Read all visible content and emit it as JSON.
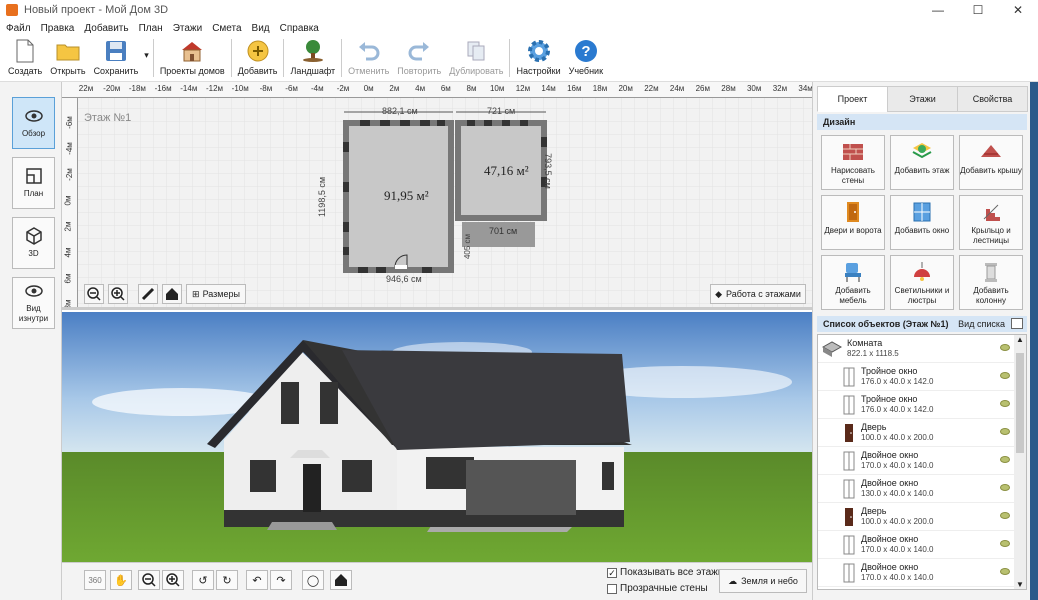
{
  "window": {
    "title": "Новый проект - Мой Дом 3D"
  },
  "menu": [
    "Файл",
    "Правка",
    "Добавить",
    "План",
    "Этажи",
    "Смета",
    "Вид",
    "Справка"
  ],
  "toolbar": {
    "create": "Создать",
    "open": "Открыть",
    "save": "Сохранить",
    "house_projects": "Проекты домов",
    "add": "Добавить",
    "landscape": "Ландшафт",
    "undo": "Отменить",
    "redo": "Повторить",
    "duplicate": "Дублировать",
    "settings": "Настройки",
    "tutorial": "Учебник"
  },
  "views": {
    "overview": "Обзор",
    "plan": "План",
    "threed": "3D",
    "inside": "Вид изнутри"
  },
  "plan": {
    "floor_label": "Этаж №1",
    "ruler_top": [
      "22м",
      "-20м",
      "-18м",
      "-16м",
      "-14м",
      "-12м",
      "-10м",
      "-8м",
      "-6м",
      "-4м",
      "-2м",
      "0м",
      "2м",
      "4м",
      "6м",
      "8м",
      "10м",
      "12м",
      "14м",
      "16м",
      "18м",
      "20м",
      "22м",
      "24м",
      "26м",
      "28м",
      "30м",
      "32м",
      "34м"
    ],
    "ruler_left": [
      "-6м",
      "-4м",
      "-2м",
      "0м",
      "2м",
      "4м",
      "6м",
      "8м"
    ],
    "room1_area": "91,95 м²",
    "room2_area": "47,16 м²",
    "dim_top1": "882,1 см",
    "dim_top2": "721 см",
    "dim_left": "1198,5 см",
    "dim_right": "793,5 см",
    "dim_terrace": "701 см",
    "dim_405": "405 см",
    "dim_bottom": "946,6 см",
    "sizes_btn": "Размеры",
    "floors_btn": "Работа с этажами"
  },
  "bottom": {
    "show_all": "Показывать все этажи",
    "transparent": "Прозрачные стены",
    "ground_sky": "Земля и небо",
    "show_all_checked": true,
    "transparent_checked": false
  },
  "right": {
    "tabs": [
      "Проект",
      "Этажи",
      "Свойства"
    ],
    "design_header": "Дизайн",
    "design_buttons": [
      "Нарисовать стены",
      "Добавить этаж",
      "Добавить крышу",
      "Двери и ворота",
      "Добавить окно",
      "Крыльцо и лестницы",
      "Добавить мебель",
      "Светильники и люстры",
      "Добавить колонну"
    ],
    "list_header": "Список объектов (Этаж №1)",
    "list_view": "Вид списка",
    "objects": [
      {
        "name": "Комната",
        "dim": "822.1 x 1118.5"
      },
      {
        "name": "Тройное окно",
        "dim": "176.0 x 40.0 x 142.0"
      },
      {
        "name": "Тройное окно",
        "dim": "176.0 x 40.0 x 142.0"
      },
      {
        "name": "Дверь",
        "dim": "100.0 x 40.0 x 200.0"
      },
      {
        "name": "Двойное окно",
        "dim": "170.0 x 40.0 x 140.0"
      },
      {
        "name": "Двойное окно",
        "dim": "130.0 x 40.0 x 140.0"
      },
      {
        "name": "Дверь",
        "dim": "100.0 x 40.0 x 200.0"
      },
      {
        "name": "Двойное окно",
        "dim": "170.0 x 40.0 x 140.0"
      },
      {
        "name": "Двойное окно",
        "dim": "170.0 x 40.0 x 140.0"
      }
    ]
  }
}
